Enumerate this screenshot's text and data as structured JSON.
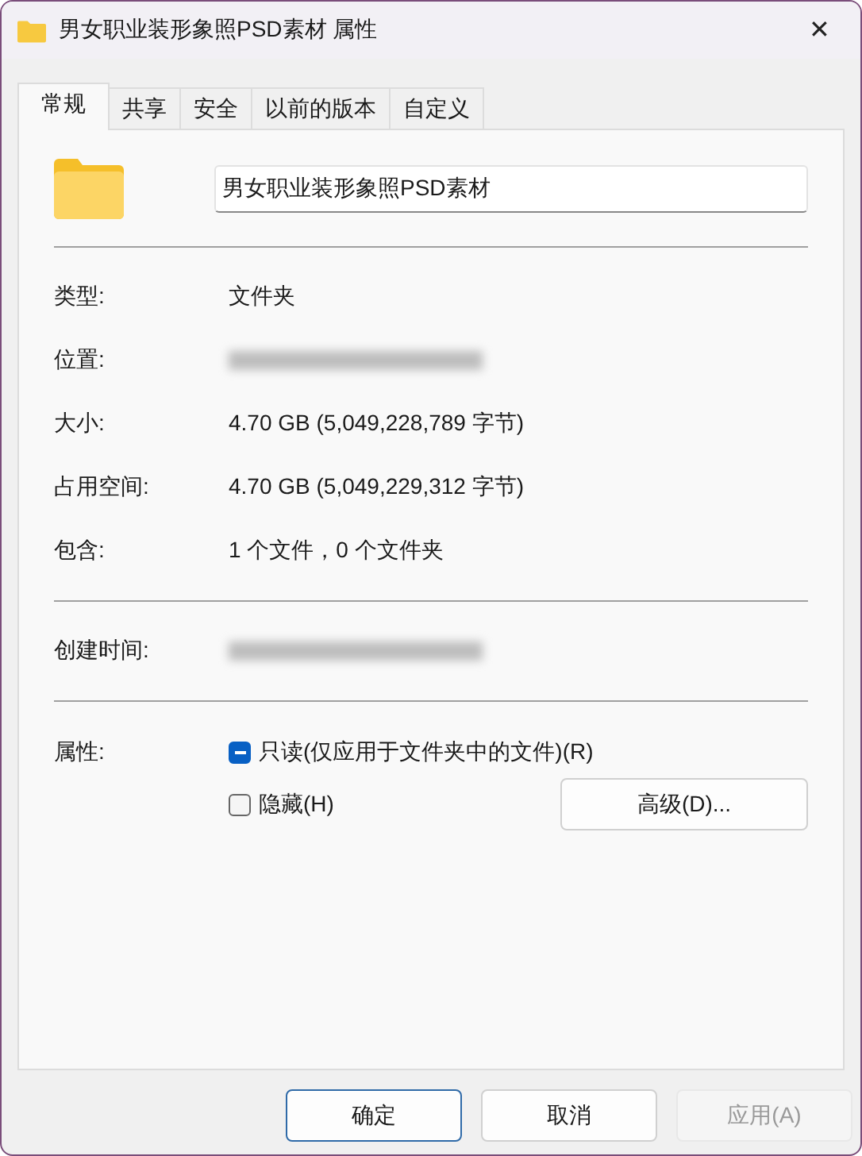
{
  "window": {
    "title": "男女职业装形象照PSD素材 属性",
    "close": "✕"
  },
  "tabs": [
    {
      "label": "常规",
      "selected": true
    },
    {
      "label": "共享",
      "selected": false
    },
    {
      "label": "安全",
      "selected": false
    },
    {
      "label": "以前的版本",
      "selected": false
    },
    {
      "label": "自定义",
      "selected": false
    }
  ],
  "name_field": {
    "value": "男女职业装形象照PSD素材"
  },
  "sections": [
    [
      {
        "label": "类型:",
        "kind": "text",
        "value": "文件夹"
      },
      {
        "label": "位置:",
        "kind": "redacted"
      },
      {
        "label": "大小:",
        "kind": "text",
        "value": "4.70 GB (5,049,228,789 字节)"
      },
      {
        "label": "占用空间:",
        "kind": "text",
        "value": "4.70 GB (5,049,229,312 字节)"
      },
      {
        "label": "包含:",
        "kind": "text",
        "value": "1 个文件，0 个文件夹"
      }
    ],
    [
      {
        "label": "创建时间:",
        "kind": "redacted"
      }
    ]
  ],
  "attributes": {
    "label": "属性:",
    "checkboxes": [
      {
        "label": "只读(仅应用于文件夹中的文件)(R)",
        "checked": true,
        "indeterminate": true
      },
      {
        "label": "隐藏(H)",
        "checked": false,
        "indeterminate": false
      }
    ],
    "advanced_button": "高级(D)..."
  },
  "buttons": [
    {
      "label": "确定",
      "default": true,
      "disabled": false
    },
    {
      "label": "取消",
      "default": false,
      "disabled": false
    },
    {
      "label": "应用(A)",
      "default": false,
      "disabled": true
    }
  ]
}
